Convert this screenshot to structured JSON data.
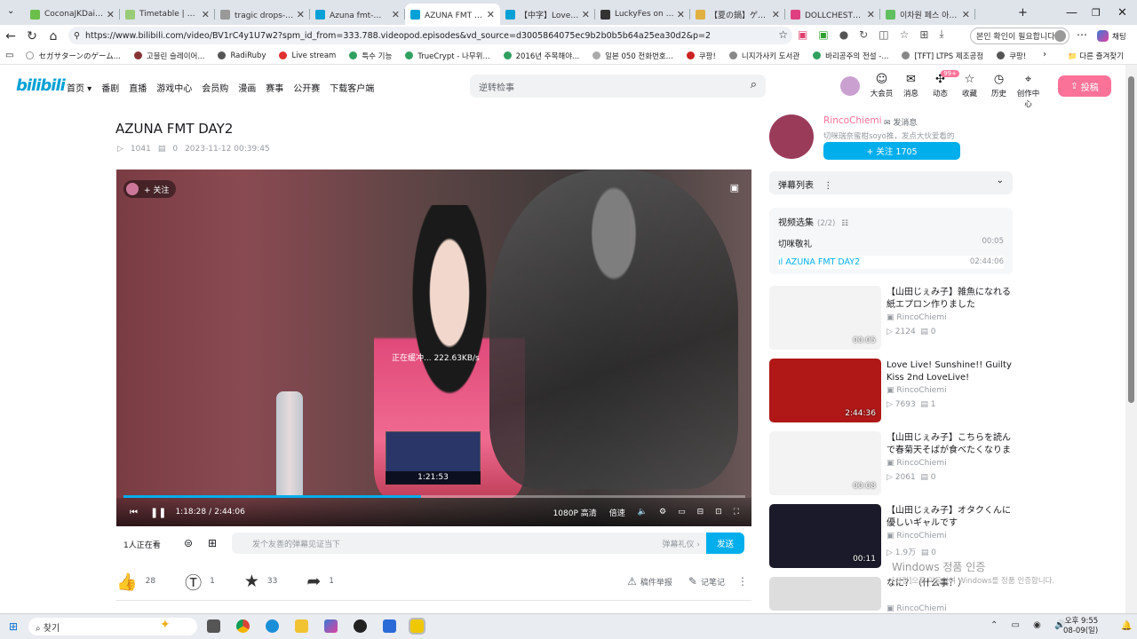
{
  "browser": {
    "tabs": [
      {
        "title": "CoconaJKDaisuki Sty",
        "color": "#6bbf4a"
      },
      {
        "title": "Timetable | Luckyfes",
        "color": "#99cc77"
      },
      {
        "title": "tragic drops-哔哩哔哩",
        "color": "#999999"
      },
      {
        "title": "Azuna fmt-哔哩哔哩",
        "color": "#00a1d6"
      },
      {
        "title": "AZUNA FMT DAY2_哔",
        "color": "#00a1d6",
        "active": true
      },
      {
        "title": "【中字】LoveLive！虹",
        "color": "#00a1d6"
      },
      {
        "title": "LuckyFes on X: \"[Sel",
        "color": "#333333"
      },
      {
        "title": "【夏の鍋】ゲスト：月ジ",
        "color": "#e0b040"
      },
      {
        "title": "DOLLCHESTRA「ア",
        "color": "#e04080"
      },
      {
        "title": "이차원 페스 아이돌",
        "color": "#60c060"
      }
    ],
    "url": "https://www.bilibili.com/video/BV1rC4y1U7w2?spm_id_from=333.788.videopod.episodes&vd_source=d3005864075ec9b2b0b5b64a25ea30d2&p=2",
    "confirm_label": "본인 확인이 필요합니다.",
    "chat_label": "채팅",
    "bookmarks": [
      {
        "label": "セガサターンのゲーム...",
        "color": "#ffffff"
      },
      {
        "label": "고블린 슬레이어...",
        "color": "#883333"
      },
      {
        "label": "RadiRuby",
        "color": "#555555"
      },
      {
        "label": "Live stream",
        "color": "#e03030"
      },
      {
        "label": "특수 기능",
        "color": "#30a060"
      },
      {
        "label": "TrueCrypt - 나무위...",
        "color": "#30a060"
      },
      {
        "label": "2016년 주목해야...",
        "color": "#30a060"
      },
      {
        "label": "일본 050 전화번호...",
        "color": "#aaaaaa"
      },
      {
        "label": "쿠팡!",
        "color": "#cc2222"
      },
      {
        "label": "니지가사키 도서관",
        "color": "#888888"
      },
      {
        "label": "바리공주의 전설 -...",
        "color": "#30a060"
      },
      {
        "label": "[TFT] LTPS 제조공정",
        "color": "#888888"
      },
      {
        "label": "쿠팡!",
        "color": "#555555"
      }
    ],
    "other_bookmarks": "다른 즐겨찾기"
  },
  "header": {
    "logo": "bilibili",
    "nav": [
      "首页 ▾",
      "番剧",
      "直播",
      "游戏中心",
      "会员购",
      "漫画",
      "赛事",
      "公开赛",
      "下载客户端"
    ],
    "search_placeholder": "逆转检事",
    "icons": [
      {
        "label": "大会员",
        "icon": "vip-icon"
      },
      {
        "label": "消息",
        "icon": "message-icon"
      },
      {
        "label": "动态",
        "icon": "dynamic-icon",
        "badge": "99+"
      },
      {
        "label": "收藏",
        "icon": "favorite-icon"
      },
      {
        "label": "历史",
        "icon": "history-icon"
      },
      {
        "label": "创作中心",
        "icon": "creator-icon"
      }
    ],
    "upload": "投稿"
  },
  "video": {
    "title": "AZUNA FMT DAY2",
    "plays": "1041",
    "danmaku": "0",
    "date": "2023-11-12 00:39:45",
    "follow": "+ 关注",
    "loading": "正在缓冲... 222.63KB/s",
    "hover_time": "1:21:53",
    "current": "1:18:28",
    "duration": "2:44:06",
    "progress": 0.478,
    "quality": "1080P 高清",
    "speed": "倍速"
  },
  "danmaku_bar": {
    "watching": "1人正在看",
    "placeholder": "发个友善的弹幕见证当下",
    "etiquette": "弹幕礼仪 ›",
    "send": "发送"
  },
  "actions": {
    "like": "28",
    "coin": "1",
    "fav": "33",
    "share": "1",
    "report": "稿件举报",
    "note": "记笔记"
  },
  "uploader": {
    "name": "RincoChiemi",
    "message": "发消息",
    "desc": "切咪瑞奈蜜柑soyo推，发点大伙爱看的",
    "follow": "+ 关注 1705"
  },
  "sidebar": {
    "danmaku_list": "弹幕列表",
    "collection_title": "视频选集",
    "collection_count": "(2/2)",
    "episodes": [
      {
        "title": "切咪敬礼",
        "duration": "00:05"
      },
      {
        "title": "AZUNA FMT DAY2",
        "duration": "02:44:06",
        "active": true
      }
    ],
    "recommendations": [
      {
        "title": "【山田じぇみ子】雑魚になれる紙エプロン作りました",
        "uploader": "RincoChiemi",
        "plays": "2124",
        "danmaku": "0",
        "duration": "00:05",
        "color": "#f3f3f3"
      },
      {
        "title": "Love Live! Sunshine!! Guilty Kiss 2nd LoveLive! ~Return~",
        "uploader": "RincoChiemi",
        "plays": "7693",
        "danmaku": "1",
        "duration": "2:44:36",
        "color": "#b01818"
      },
      {
        "title": "【山田じぇみ子】こちらを読んで春菊天そばが食べたくなりました",
        "uploader": "RincoChiemi",
        "plays": "2061",
        "danmaku": "0",
        "duration": "00:08",
        "color": "#f3f3f3"
      },
      {
        "title": "【山田じぇみ子】オタクくんに優しいギャルです",
        "uploader": "RincoChiemi",
        "plays": "1.9万",
        "danmaku": "0",
        "duration": "00:11",
        "color": "#1a1a2a"
      },
      {
        "title": "なに？（什么事？）",
        "uploader": "RincoChiemi",
        "plays": "1.7万",
        "danmaku": "5",
        "duration": "",
        "color": "#dddddd"
      }
    ]
  },
  "watermark": {
    "line1": "Windows 정품 인증",
    "line2": "[설정]으로 이동하여 Windows를 정품 인증합니다."
  },
  "taskbar": {
    "search": "찾기",
    "time": "오후 9:55",
    "date": "08-09(일)"
  }
}
